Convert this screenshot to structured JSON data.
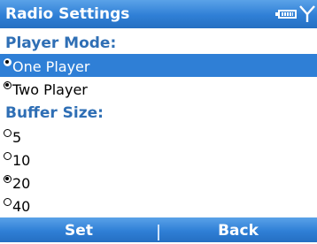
{
  "title_bar": {
    "title": "Radio Settings",
    "icons": [
      "battery-icon",
      "signal-icon"
    ]
  },
  "player_mode": {
    "heading": "Player Mode:",
    "options": [
      {
        "label": "One Player",
        "checked": false,
        "focused": true
      },
      {
        "label": "Two Player",
        "checked": true,
        "focused": false
      }
    ]
  },
  "buffer_size": {
    "heading": "Buffer Size:",
    "options": [
      {
        "label": "5",
        "checked": false
      },
      {
        "label": "10",
        "checked": false
      },
      {
        "label": "20",
        "checked": true
      },
      {
        "label": "40",
        "checked": false
      }
    ]
  },
  "softkeys": {
    "left": "Set",
    "right": "Back"
  },
  "colors": {
    "accent": "#2f7fd6",
    "heading": "#2f6fb5"
  }
}
